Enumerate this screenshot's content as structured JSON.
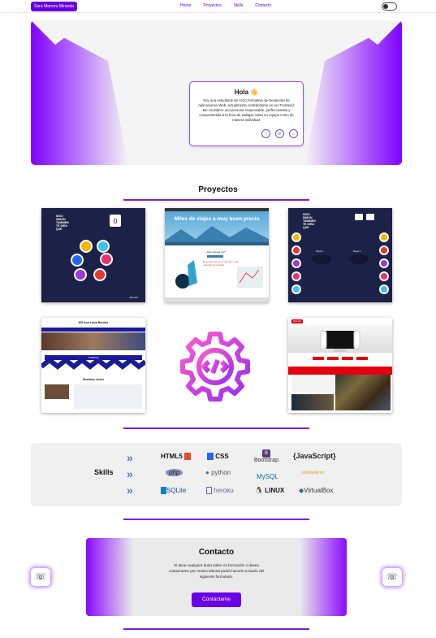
{
  "nav": {
    "brand": "Sara Marrero Miranda",
    "links": [
      "Home",
      "Proyectos",
      "Skills",
      "Contacto"
    ]
  },
  "hero": {
    "title": "Hola 👋",
    "text": "Soy una estudiante de Ciclo Formativo de Desarrollo de Aplicaciones Web, actualmente centrándome en ser Frontend. Me considero una persona responsable, perfeccionista y comprometida a la hora de trabajar, tanto en equipo como de manera individual.",
    "social_icons": [
      "github-icon",
      "linkedin-icon",
      "institution-icon"
    ]
  },
  "projects": {
    "title": "Proyectos",
    "p1": {
      "lines": [
        "SIGO",
        "SIMON",
        "TAMBIEN",
        "TE DIRA",
        "QUE"
      ],
      "score": "0",
      "tag": "COLOR"
    },
    "p2": {
      "banner": "Miles de viajes a muy buen precio",
      "q": "¿Qué quieres ver?",
      "heading": "Descubre que una sencillez está ofrecida sin pérdida"
    },
    "p3": {
      "lines": [
        "SIGO",
        "SIMON",
        "TAMBIEN",
        "TE DIRA",
        "QUE"
      ],
      "p1": "Player 1",
      "p2": "Player 2"
    },
    "p4": {
      "title": "IES Ana Luisa Benítez",
      "section": "Nuestros ciclos",
      "campus": "CAMPUS"
    },
    "p6": {
      "logo": "Nintendo"
    }
  },
  "skills": {
    "title": "Skills",
    "logos": [
      "HTML5",
      "CSS",
      "Bootstrap",
      "{JavaScript}",
      "php",
      "python",
      "MySQL",
      "phpMyAdmin",
      "SQLite",
      "heroku",
      "LINUX",
      "VirtualBox"
    ]
  },
  "contact": {
    "title": "Contacto",
    "text": "Si tiene cualquier duda sobre mi formación o desea contactarme por motivo laboral podrá hacerlo a través del siguiente formulario.",
    "button": "Contáctame"
  }
}
